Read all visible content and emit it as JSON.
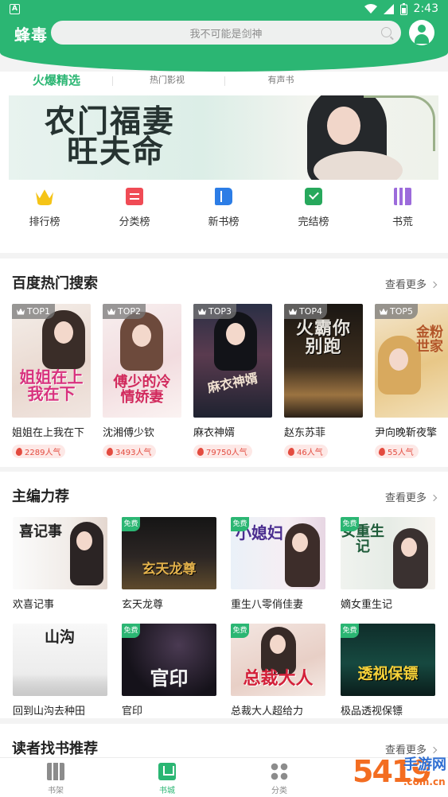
{
  "status_bar": {
    "time": "2:43",
    "indicator": "A"
  },
  "header": {
    "logo": "蜂毒",
    "search_placeholder": "我不可能是剑神"
  },
  "tabs": [
    {
      "label": "火爆精选",
      "active": true
    },
    {
      "label": "热门影视",
      "active": false
    },
    {
      "label": "有声书",
      "active": false
    }
  ],
  "banner": {
    "title_line1": "农门福妻",
    "title_line2": "旺夫命"
  },
  "nav": [
    {
      "label": "排行榜",
      "icon": "crown-icon"
    },
    {
      "label": "分类榜",
      "icon": "category-icon"
    },
    {
      "label": "新书榜",
      "icon": "new-book-icon"
    },
    {
      "label": "完结榜",
      "icon": "finished-icon"
    },
    {
      "label": "书荒",
      "icon": "bookshelf-icon"
    }
  ],
  "hot_search": {
    "title": "百度热门搜索",
    "more": "查看更多",
    "books": [
      {
        "rank": "TOP1",
        "title": "姐姐在上我在下",
        "popularity": "2289人气",
        "cover_text": "姐姐在上我在下"
      },
      {
        "rank": "TOP2",
        "title": "沈湘傅少钦",
        "popularity": "3493人气",
        "cover_text": "傅少的冷情娇妻"
      },
      {
        "rank": "TOP3",
        "title": "麻衣神婿",
        "popularity": "79750人气",
        "cover_text": "麻衣神婿"
      },
      {
        "rank": "TOP4",
        "title": "赵东苏菲",
        "popularity": "46人气",
        "cover_text": "火霸你别跑"
      },
      {
        "rank": "TOP5",
        "title": "尹向晚靳夜擎",
        "popularity": "55人气",
        "cover_text": "金粉世家"
      }
    ]
  },
  "editor_picks": {
    "title": "主编力荐",
    "more": "查看更多",
    "free_tag": "免费",
    "books": [
      {
        "title": "欢喜记事",
        "cover_text": "喜记事",
        "free": false
      },
      {
        "title": "玄天龙尊",
        "cover_text": "玄天龙尊",
        "free": true
      },
      {
        "title": "重生八零俏佳妻",
        "cover_text": "小媳妇",
        "free": true
      },
      {
        "title": "嫡女重生记",
        "cover_text": "女重生记",
        "free": true
      },
      {
        "title": "回到山沟去种田",
        "cover_text": "山沟",
        "free": false
      },
      {
        "title": "官印",
        "cover_text": "官印",
        "free": true
      },
      {
        "title": "总裁大人超给力",
        "cover_text": "总裁大人",
        "free": true
      },
      {
        "title": "极品透视保镖",
        "cover_text": "透视保镖",
        "free": true
      }
    ]
  },
  "reader_rec": {
    "title": "读者找书推荐",
    "more": "查看更多"
  },
  "tabbar": [
    {
      "label": "书架",
      "icon": "bookshelf-icon",
      "active": false
    },
    {
      "label": "书城",
      "icon": "bookstore-icon",
      "active": true
    },
    {
      "label": "分类",
      "icon": "category-icon",
      "active": false
    }
  ],
  "watermark": {
    "big": "5419",
    "right": "手游网",
    "url": ".com.cn"
  },
  "colors": {
    "brand": "#2bb673",
    "hot": "#e34b3f"
  }
}
